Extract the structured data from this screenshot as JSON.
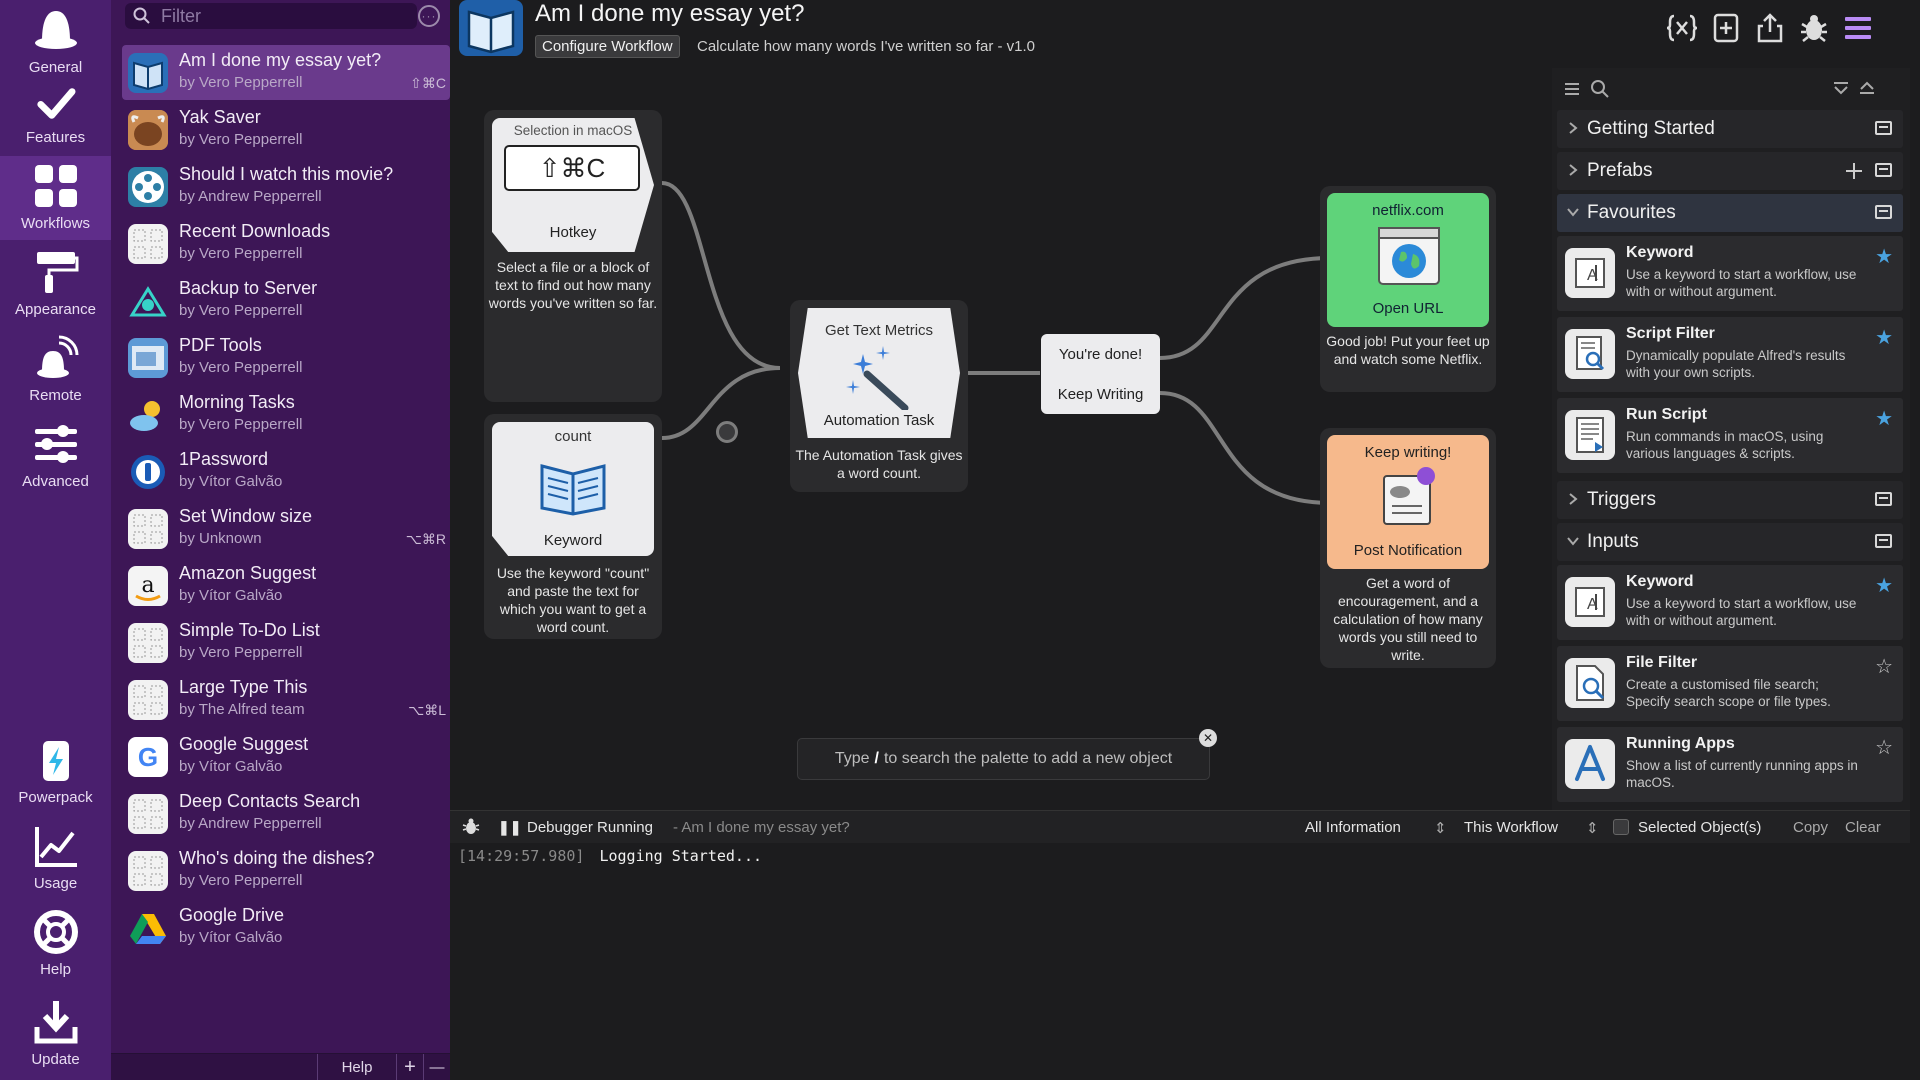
{
  "nav": {
    "general": "General",
    "features": "Features",
    "workflows": "Workflows",
    "appearance": "Appearance",
    "remote": "Remote",
    "advanced": "Advanced",
    "powerpack": "Powerpack",
    "usage": "Usage",
    "help": "Help",
    "update": "Update"
  },
  "list": {
    "filter_placeholder": "Filter",
    "items": [
      {
        "title": "Am I done my essay yet?",
        "author": "by Vero Pepperrell",
        "shortcut": "⇧⌘C"
      },
      {
        "title": "Yak Saver",
        "author": "by Vero Pepperrell",
        "shortcut": ""
      },
      {
        "title": "Should I watch this movie?",
        "author": "by Andrew Pepperrell",
        "shortcut": ""
      },
      {
        "title": "Recent Downloads",
        "author": "by Vero Pepperrell",
        "shortcut": ""
      },
      {
        "title": "Backup to Server",
        "author": "by Vero Pepperrell",
        "shortcut": ""
      },
      {
        "title": "PDF Tools",
        "author": "by Vero Pepperrell",
        "shortcut": ""
      },
      {
        "title": "Morning Tasks",
        "author": "by Vero Pepperrell",
        "shortcut": ""
      },
      {
        "title": "1Password",
        "author": "by Vítor Galvão",
        "shortcut": ""
      },
      {
        "title": "Set Window size",
        "author": "by Unknown",
        "shortcut": "⌥⌘R"
      },
      {
        "title": "Amazon Suggest",
        "author": "by Vítor Galvão",
        "shortcut": ""
      },
      {
        "title": "Simple To-Do List",
        "author": "by Vero Pepperrell",
        "shortcut": ""
      },
      {
        "title": "Large Type This",
        "author": "by The Alfred team",
        "shortcut": "⌥⌘L"
      },
      {
        "title": "Google Suggest",
        "author": "by Vítor Galvão",
        "shortcut": ""
      },
      {
        "title": "Deep Contacts Search",
        "author": "by Andrew Pepperrell",
        "shortcut": ""
      },
      {
        "title": "Who's doing the dishes?",
        "author": "by Vero Pepperrell",
        "shortcut": ""
      },
      {
        "title": "Google Drive",
        "author": "by Vítor Galvão",
        "shortcut": ""
      }
    ],
    "footer": {
      "help": "Help",
      "add": "+",
      "remove": "—"
    }
  },
  "header": {
    "title": "Am I done my essay yet?",
    "configure": "Configure Workflow",
    "description": "Calculate how many words I've written so far - v1.0"
  },
  "canvas": {
    "hotkey": {
      "label_top": "Selection in macOS",
      "keys": "⇧⌘C",
      "type": "Hotkey",
      "note": "Select a file or a block of text to find out how many words you've written so far."
    },
    "keyword": {
      "label_top": "count",
      "type": "Keyword",
      "note": "Use the keyword \"count\" and paste the text for which you want to get a word count."
    },
    "automation": {
      "label_top": "Get Text Metrics",
      "type": "Automation Task",
      "note": "The Automation Task gives a word count."
    },
    "conditional": {
      "option1": "You're done!",
      "option2": "Keep Writing"
    },
    "open_url": {
      "label_top": "netflix.com",
      "type": "Open URL",
      "note": "Good job! Put your feet up and watch some Netflix."
    },
    "notification": {
      "label_top": "Keep writing!",
      "type": "Post Notification",
      "note": "Get a word of encouragement, and a calculation of how many words you still need to write."
    },
    "palette_hint_pre": "Type",
    "palette_hint_key": "/",
    "palette_hint_post": "to search the palette to add a new object"
  },
  "palette": {
    "sections": {
      "getting_started": "Getting Started",
      "prefabs": "Prefabs",
      "favourites": "Favourites",
      "triggers": "Triggers",
      "inputs": "Inputs"
    },
    "favourites": [
      {
        "title": "Keyword",
        "desc": "Use a keyword to start a workflow, use with or without argument."
      },
      {
        "title": "Script Filter",
        "desc": "Dynamically populate Alfred's results with your own scripts."
      },
      {
        "title": "Run Script",
        "desc": "Run commands in macOS, using various languages & scripts."
      }
    ],
    "inputs": [
      {
        "title": "Keyword",
        "desc": "Use a keyword to start a workflow, use with or without argument."
      },
      {
        "title": "File Filter",
        "desc": "Create a customised file search; Specify search scope or file types."
      },
      {
        "title": "Running Apps",
        "desc": "Show a list of currently running apps in macOS."
      }
    ]
  },
  "debugger": {
    "status": "Debugger Running",
    "workflow": "- Am I done my essay yet?",
    "filter_level": "All Information",
    "scope": "This Workflow",
    "selected_objects": "Selected Object(s)",
    "copy": "Copy",
    "clear": "Clear",
    "log_time": "[14:29:57.980]",
    "log_msg": "Logging Started..."
  },
  "colors": {
    "nav_bg": "#4a1f6e",
    "list_bg": "#3d1656",
    "selected_item": "#6a3a8c",
    "open_url_green": "#5fd37a",
    "notification_peach": "#f6b98c",
    "star_blue": "#4aa3e0"
  }
}
